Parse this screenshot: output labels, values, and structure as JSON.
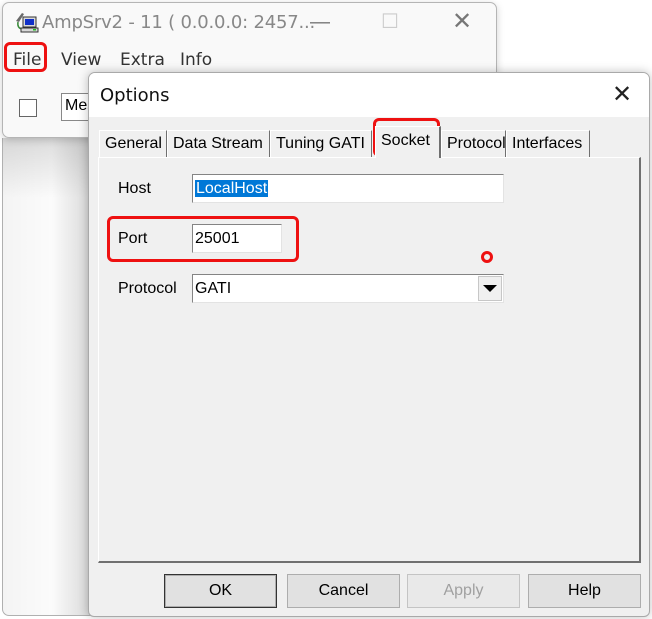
{
  "main_window": {
    "title": "AmpSrv2 - 11 ( 0.0.0.0: 2457...",
    "icon": "network-computer-icon",
    "controls": {
      "minimize": "—",
      "maximize": "☐",
      "close": "✕"
    },
    "menu": [
      {
        "label": "File",
        "highlighted": true
      },
      {
        "label": "View"
      },
      {
        "label": "Extra"
      },
      {
        "label": "Info"
      }
    ],
    "field_partial_text": "Mes",
    "checkbox_checked": false
  },
  "dialog": {
    "title": "Options",
    "close_glyph": "✕",
    "tabs": [
      {
        "label": "General",
        "active": false
      },
      {
        "label": "Data Stream",
        "active": false
      },
      {
        "label": "Tuning GATI",
        "active": false
      },
      {
        "label": "Socket",
        "active": true,
        "highlighted": true
      },
      {
        "label": "Protocol",
        "active": false
      },
      {
        "label": "Interfaces",
        "active": false
      }
    ],
    "socket": {
      "host_label": "Host",
      "host_value": "LocalHost",
      "port_label": "Port",
      "port_value": "25001",
      "protocol_label": "Protocol",
      "protocol_value": "GATI"
    },
    "buttons": {
      "ok": "OK",
      "cancel": "Cancel",
      "apply": "Apply",
      "help": "Help"
    }
  },
  "colors": {
    "highlight": "#ee1111",
    "selection": "#0078d7"
  }
}
